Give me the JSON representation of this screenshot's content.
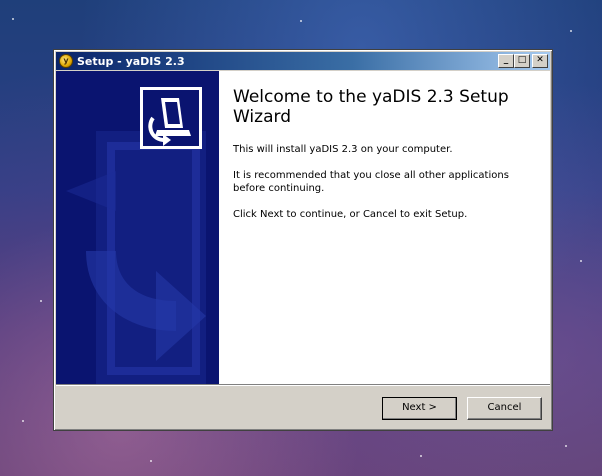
{
  "window": {
    "title": "Setup - yaDIS 2.3",
    "icon": "setup-app-icon",
    "minimize": "_",
    "maximize": "□",
    "close": "✕"
  },
  "content": {
    "heading": "Welcome to the yaDIS 2.3 Setup Wizard",
    "paragraphs": [
      "This will install yaDIS 2.3 on your computer.",
      "It is recommended that you close all other applications before continuing.",
      "Click Next to continue, or Cancel to exit Setup."
    ]
  },
  "buttons": {
    "next": "Next >",
    "cancel": "Cancel"
  },
  "colors": {
    "titlebar": "#0a246a",
    "panel": "#0a1470",
    "face": "#d4d0c8"
  }
}
